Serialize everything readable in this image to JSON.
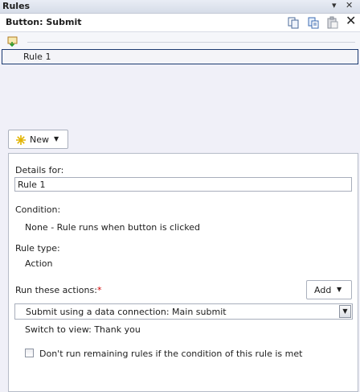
{
  "window": {
    "title": "Rules",
    "menu_glyph": "▾",
    "close_glyph": "✕"
  },
  "header": {
    "control_name": "Button: Submit"
  },
  "toolbar": {
    "icons": [
      "copy-icon",
      "paste-rule-icon",
      "paste-icon",
      "close-icon"
    ],
    "close_glyph": "✕"
  },
  "rules": [
    {
      "label": "Rule 1"
    }
  ],
  "new_button": {
    "label": "New",
    "arrow": "▼"
  },
  "details": {
    "details_for_label": "Details for:",
    "rule_name": "Rule 1",
    "condition_label": "Condition:",
    "condition_value": "None - Rule runs when button is clicked",
    "rule_type_label": "Rule type:",
    "rule_type_value": "Action",
    "run_actions_label": "Run these actions:",
    "required_mark": "*",
    "add_button": {
      "label": "Add",
      "arrow": "▼"
    },
    "action_item": "Submit using a data connection: Main submit",
    "action_dropdown_arrow": "▼",
    "switch_view_text": "Switch to view: Thank you",
    "dont_run_label": "Don't run remaining rules if the condition of this rule is met",
    "dont_run_checked": false
  },
  "colors": {
    "selection_border": "#1c3a70",
    "panel_bg": "#f0f0f8",
    "required": "#d00000"
  }
}
